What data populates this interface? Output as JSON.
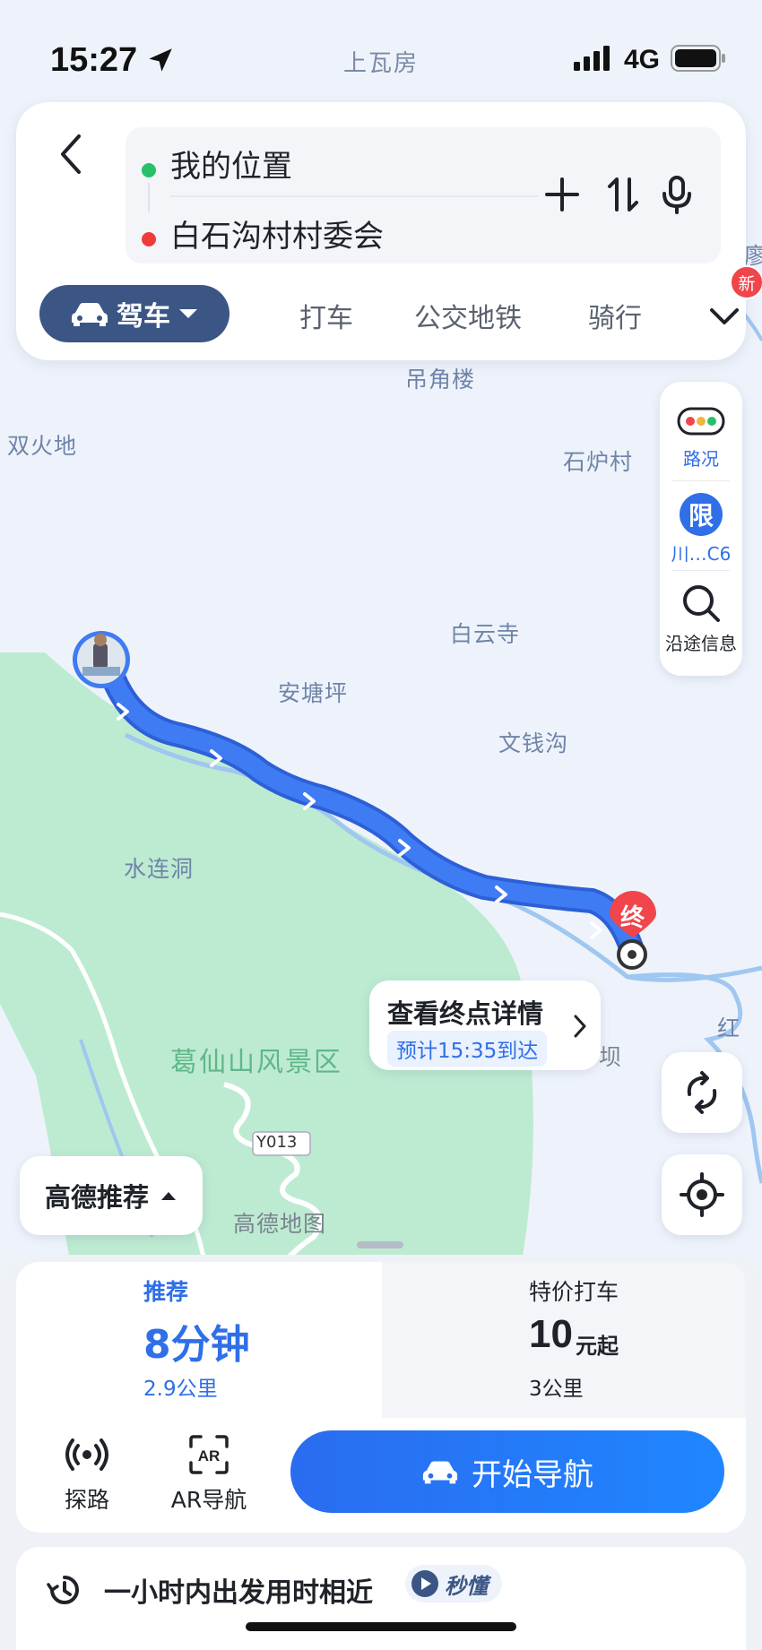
{
  "status_bar": {
    "time": "15:27",
    "place": "上瓦房",
    "network": "4G"
  },
  "route_input": {
    "origin": "我的位置",
    "destination": "白石沟村村委会"
  },
  "modes": {
    "drive": "驾车",
    "taxi": "打车",
    "transit": "公交地铁",
    "bike": "骑行",
    "new_badge": "新"
  },
  "tools": {
    "traffic": "路况",
    "limit_icon": "限",
    "limit": "川…C6",
    "info": "沿途信息"
  },
  "map_labels": {
    "diaojiaolou": "吊角楼",
    "shuanghuodi": "双火地",
    "shilucun": "石炉村",
    "baiyunsi": "白云寺",
    "antangping": "安塘坪",
    "wenqiangou": "文钱沟",
    "shuiliandong": "水连洞",
    "scenic": "葛仙山风景区",
    "road": "Y013",
    "watermark": "高德地图",
    "ba": "坝",
    "hong": "红",
    "liao": "廖"
  },
  "markers": {
    "end": "终"
  },
  "callout": {
    "title": "查看终点详情",
    "eta": "预计15:35到达"
  },
  "recommend_toggle": "高德推荐",
  "plans": {
    "recommend": {
      "label": "推荐",
      "time": "8分钟",
      "distance": "2.9公里"
    },
    "taxi": {
      "label": "特价打车",
      "price": "10",
      "unit": "元起",
      "distance": "3公里"
    }
  },
  "actions": {
    "explore": "探路",
    "ar": "AR导航",
    "start": "开始导航"
  },
  "tip": {
    "text": "一小时内出发用时相近",
    "badge": "秒懂"
  },
  "colors": {
    "route": "#3f7bf2",
    "primary": "#2f6fe8",
    "drive_tab": "#3b5585",
    "park": "#bdebd1"
  }
}
